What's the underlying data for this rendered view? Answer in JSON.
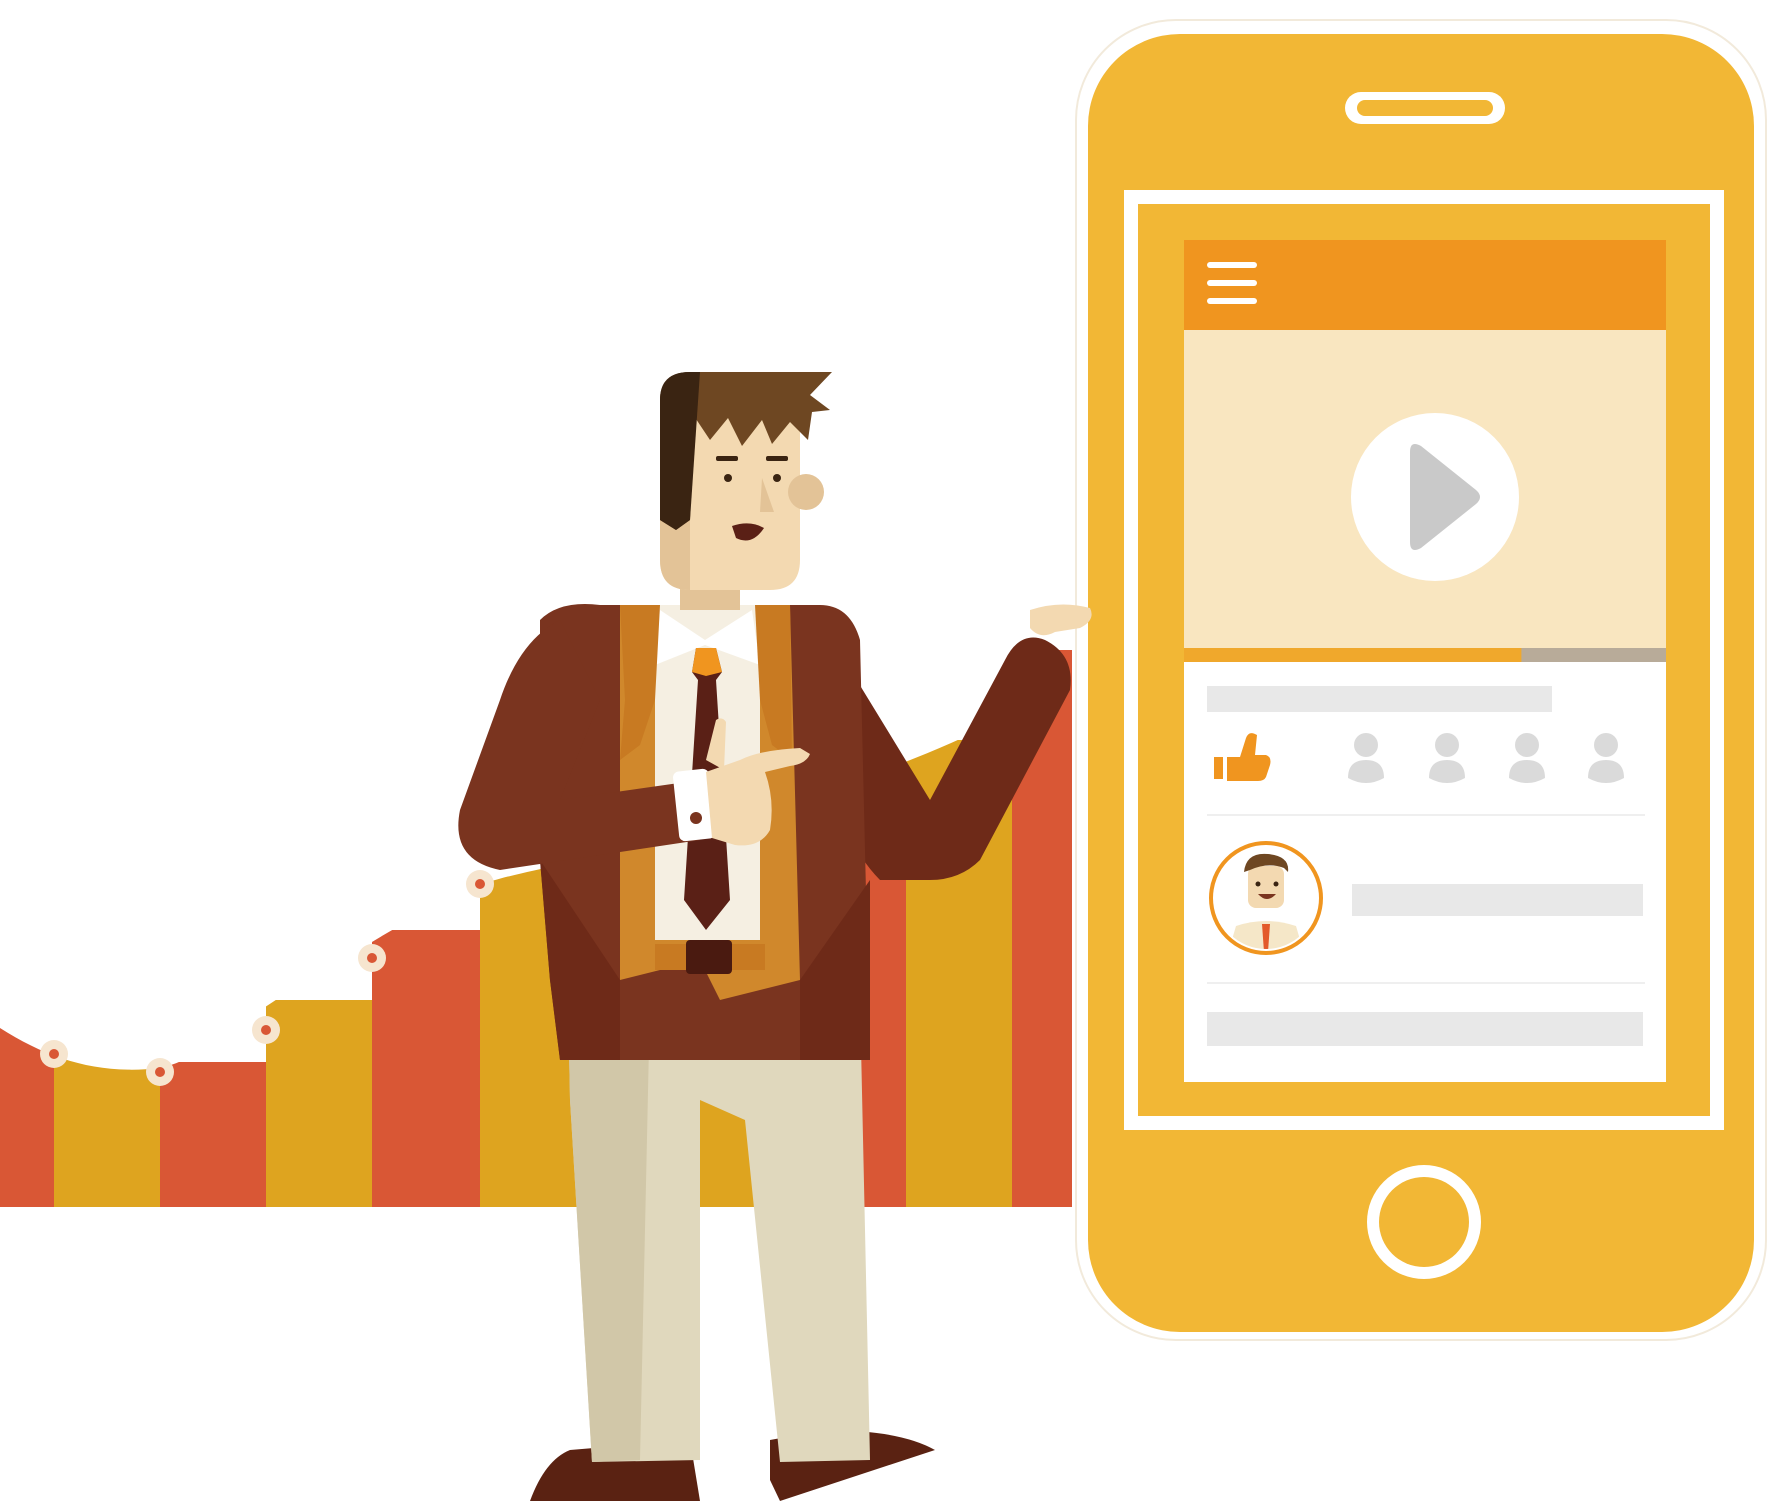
{
  "illustration": {
    "colors": {
      "background": "#ffffff",
      "bar_red": "#d95735",
      "bar_gold": "#dea41f",
      "phone_body": "#f2b735",
      "phone_outline": "#ffffff",
      "app_header": "#f0951f",
      "video_area": "#f9e6c0",
      "progress_played": "#f0a82c",
      "progress_rest": "#b8ab99",
      "placeholder": "#e8e8e8",
      "person_icon": "#dadada",
      "jacket": "#7a341f",
      "vest": "#d0882c",
      "skin": "#f3d9b1",
      "hair": "#6e4722",
      "pants": "#e0d8bd",
      "tie": "#5a2016"
    },
    "icons": [
      "hamburger-menu-icon",
      "play-icon",
      "thumbs-up-icon",
      "person-icon",
      "avatar-icon",
      "home-button-icon",
      "speaker-slot-icon"
    ],
    "video_progress_fraction": 0.7,
    "growth_bar_count": 11,
    "liked_by_count": 4
  }
}
